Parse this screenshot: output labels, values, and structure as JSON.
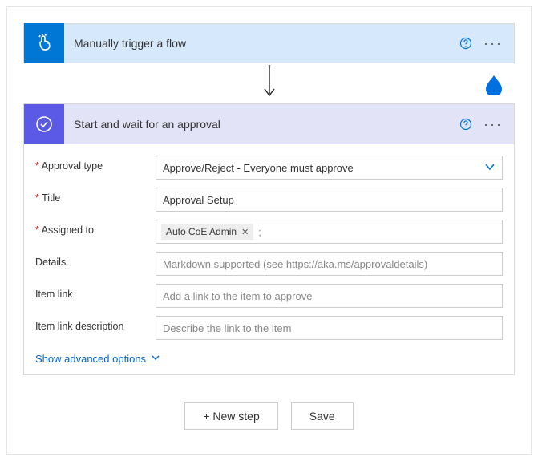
{
  "trigger": {
    "title": "Manually trigger a flow"
  },
  "action": {
    "title": "Start and wait for an approval",
    "fields": {
      "approval_type": {
        "label": "Approval type",
        "value": "Approve/Reject - Everyone must approve"
      },
      "title_field": {
        "label": "Title",
        "value": "Approval Setup"
      },
      "assigned_to": {
        "label": "Assigned to",
        "chip": "Auto CoE Admin",
        "suffix": ";"
      },
      "details": {
        "label": "Details",
        "placeholder": "Markdown supported (see https://aka.ms/approvaldetails)"
      },
      "item_link": {
        "label": "Item link",
        "placeholder": "Add a link to the item to approve"
      },
      "item_link_desc": {
        "label": "Item link description",
        "placeholder": "Describe the link to the item"
      }
    },
    "advanced": "Show advanced options"
  },
  "footer": {
    "new_step": "+ New step",
    "save": "Save"
  }
}
